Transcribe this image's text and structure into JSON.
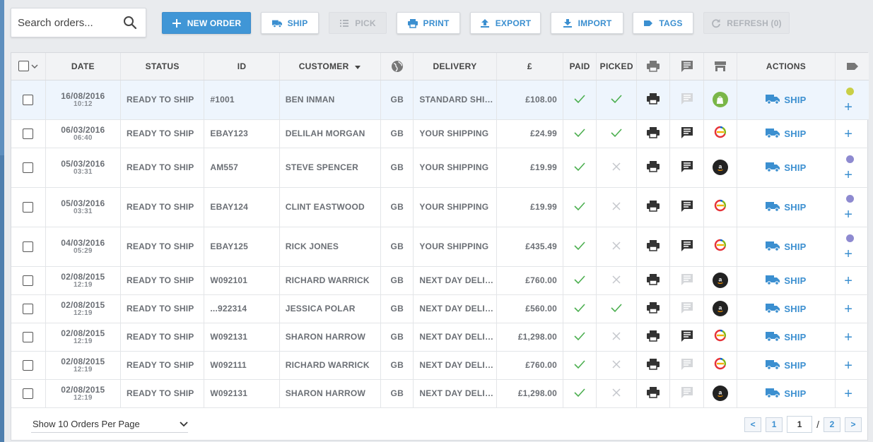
{
  "search": {
    "placeholder": "Search orders..."
  },
  "toolbar": {
    "new_order": "NEW ORDER",
    "ship": "SHIP",
    "pick": "PICK",
    "print": "PRINT",
    "export": "EXPORT",
    "import": "IMPORT",
    "tags": "TAGS",
    "refresh": "REFRESH (0)"
  },
  "columns": {
    "date": "DATE",
    "status": "STATUS",
    "id": "ID",
    "customer": "CUSTOMER",
    "delivery": "DELIVERY",
    "amount": "£",
    "paid": "PAID",
    "picked": "PICKED",
    "actions": "ACTIONS"
  },
  "orders": [
    {
      "date": "16/08/2016",
      "time": "10:12",
      "status": "READY TO SHIP",
      "id": "#1001",
      "customer": "BEN INMAN",
      "country": "GB",
      "delivery": "STANDARD SHIPPING",
      "amount": "£108.00",
      "paid": true,
      "picked": true,
      "note": false,
      "channel": "shopify",
      "action": "SHIP",
      "tag_color": "#c9cf46",
      "selected": true
    },
    {
      "date": "06/03/2016",
      "time": "06:40",
      "status": "READY TO SHIP",
      "id": "EBAY123",
      "customer": "DELILAH MORGAN",
      "country": "GB",
      "delivery": "YOUR SHIPPING",
      "amount": "£24.99",
      "paid": true,
      "picked": true,
      "note": true,
      "channel": "ebay",
      "action": "SHIP",
      "tag_color": ""
    },
    {
      "date": "05/03/2016",
      "time": "03:31",
      "status": "READY TO SHIP",
      "id": "AM557",
      "customer": "STEVE SPENCER",
      "country": "GB",
      "delivery": "YOUR SHIPPING",
      "amount": "£19.99",
      "paid": true,
      "picked": false,
      "note": true,
      "channel": "amazon",
      "action": "SHIP",
      "tag_color": "#8e8ad0"
    },
    {
      "date": "05/03/2016",
      "time": "03:31",
      "status": "READY TO SHIP",
      "id": "EBAY124",
      "customer": "CLINT EASTWOOD",
      "country": "GB",
      "delivery": "YOUR SHIPPING",
      "amount": "£19.99",
      "paid": true,
      "picked": false,
      "note": true,
      "channel": "ebay",
      "action": "SHIP",
      "tag_color": "#8e8ad0"
    },
    {
      "date": "04/03/2016",
      "time": "05:29",
      "status": "READY TO SHIP",
      "id": "EBAY125",
      "customer": "RICK JONES",
      "country": "GB",
      "delivery": "YOUR SHIPPING",
      "amount": "£435.49",
      "paid": true,
      "picked": false,
      "note": true,
      "channel": "ebay",
      "action": "SHIP",
      "tag_color": "#8e8ad0"
    },
    {
      "date": "02/08/2015",
      "time": "12:19",
      "status": "READY TO SHIP",
      "id": "W092101",
      "customer": "RICHARD WARRICK",
      "country": "GB",
      "delivery": "NEXT DAY DELIVERY",
      "amount": "£760.00",
      "paid": true,
      "picked": false,
      "note": false,
      "channel": "amazon",
      "action": "SHIP",
      "tag_color": ""
    },
    {
      "date": "02/08/2015",
      "time": "12:19",
      "status": "READY TO SHIP",
      "id": "...922314",
      "customer": "JESSICA POLAR",
      "country": "GB",
      "delivery": "NEXT DAY DELIVERY",
      "amount": "£560.00",
      "paid": true,
      "picked": true,
      "note": false,
      "channel": "amazon",
      "action": "SHIP",
      "tag_color": ""
    },
    {
      "date": "02/08/2015",
      "time": "12:19",
      "status": "READY TO SHIP",
      "id": "W092131",
      "customer": "SHARON HARROW",
      "country": "GB",
      "delivery": "NEXT DAY DELIVERY",
      "amount": "£1,298.00",
      "paid": true,
      "picked": false,
      "note": true,
      "channel": "ebay",
      "action": "SHIP",
      "tag_color": ""
    },
    {
      "date": "02/08/2015",
      "time": "12:19",
      "status": "READY TO SHIP",
      "id": "W092111",
      "customer": "RICHARD WARRICK",
      "country": "GB",
      "delivery": "NEXT DAY DELIVERY",
      "amount": "£760.00",
      "paid": true,
      "picked": false,
      "note": false,
      "channel": "ebay",
      "action": "SHIP",
      "tag_color": ""
    },
    {
      "date": "02/08/2015",
      "time": "12:19",
      "status": "READY TO SHIP",
      "id": "W092131",
      "customer": "SHARON HARROW",
      "country": "GB",
      "delivery": "NEXT DAY DELIVERY",
      "amount": "£1,298.00",
      "paid": true,
      "picked": false,
      "note": false,
      "channel": "amazon",
      "action": "SHIP",
      "tag_color": ""
    }
  ],
  "footer": {
    "per_page": "Show 10 Orders Per Page",
    "prev": "<",
    "first_page": "1",
    "current_page": "1",
    "separator": "/",
    "total_pages": "2",
    "next": ">"
  },
  "colors": {
    "accent": "#4096d6",
    "check": "#4caf50",
    "cross": "#c4c7cc"
  }
}
